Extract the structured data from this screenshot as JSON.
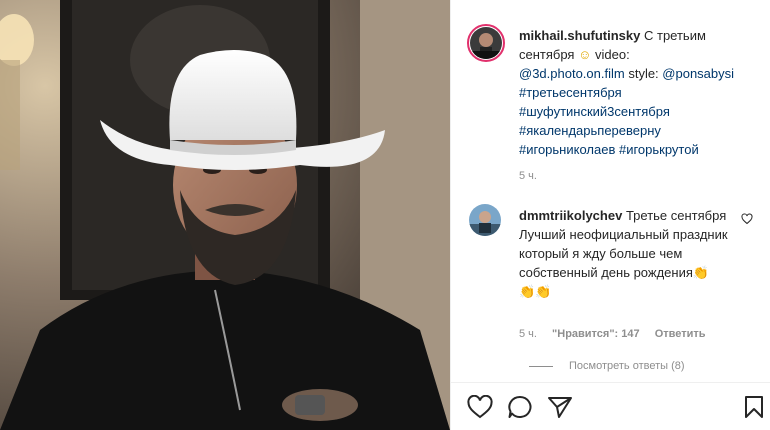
{
  "post": {
    "author": "mikhail.shufutinsky",
    "caption_text": "С третьим сентября",
    "caption_emoji": "☺",
    "video_label": "video:",
    "video_handle": "@3d.photo.on.film",
    "style_label": "style:",
    "style_handle": "@ponsabysi",
    "hashtags": [
      "#третьесентября",
      "#шуфутинский3сентября",
      "#якалендарьпереверну",
      "#игорьниколаев",
      "#игорькрутой"
    ],
    "time": "5 ч."
  },
  "comment": {
    "author": "dmmtriikolychev",
    "text": "Третье сентября Лучший неофициальный праздник который я жду больше чем собственный день рождения",
    "emoji_end": "👏",
    "emoji_line": "👏👏",
    "time": "5 ч.",
    "likes": "\"Нравится\": 147",
    "reply": "Ответить",
    "view_replies": "Посмотреть ответы (8)"
  },
  "icons": {
    "like": "heart-icon",
    "comment": "comment-icon",
    "share": "share-icon",
    "save": "bookmark-icon"
  },
  "colors": {
    "link": "#00376b",
    "meta": "#8e8e8e",
    "story_ring": "#e1306c"
  }
}
